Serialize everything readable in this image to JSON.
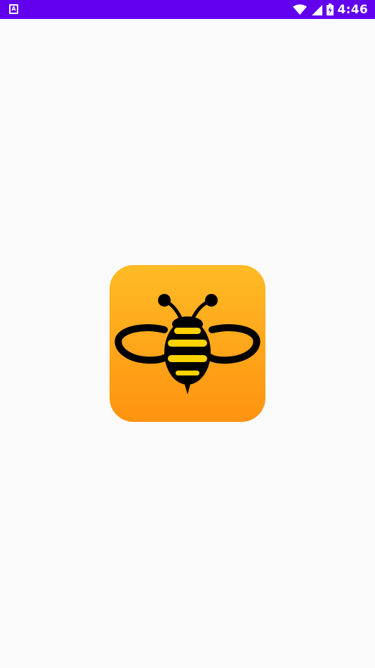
{
  "status_bar": {
    "notification_letter": "A",
    "time": "4:46",
    "icons": [
      "wifi-icon",
      "cell-signal-icon",
      "battery-charging-icon"
    ],
    "background_color": "#6200ee"
  },
  "splash": {
    "logo": "bee-logo-icon",
    "logo_colors": {
      "gradient_top": "#ffbb25",
      "gradient_bottom": "#ff9310",
      "stripe": "#ffd200",
      "outline": "#000000"
    },
    "background_color": "#fafafa"
  }
}
